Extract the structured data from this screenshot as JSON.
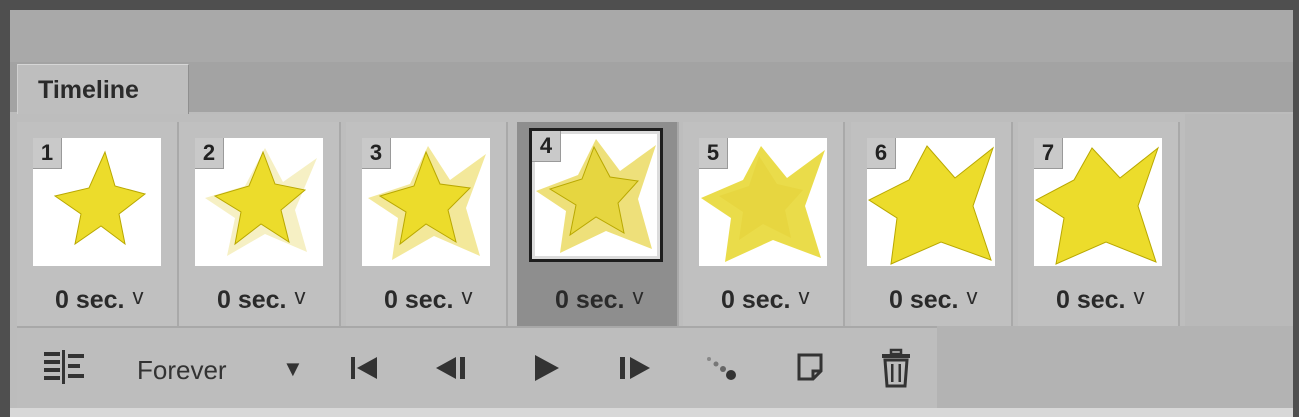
{
  "panel": {
    "tab_title": "Timeline"
  },
  "frames": [
    {
      "number": "1",
      "delay": "0 sec.",
      "chevron": "v",
      "selected": false
    },
    {
      "number": "2",
      "delay": "0 sec.",
      "chevron": "v",
      "selected": false
    },
    {
      "number": "3",
      "delay": "0 sec.",
      "chevron": "v",
      "selected": false
    },
    {
      "number": "4",
      "delay": "0 sec.",
      "chevron": "v",
      "selected": true
    },
    {
      "number": "5",
      "delay": "0 sec.",
      "chevron": "v",
      "selected": false
    },
    {
      "number": "6",
      "delay": "0 sec.",
      "chevron": "v",
      "selected": false
    },
    {
      "number": "7",
      "delay": "0 sec.",
      "chevron": "v",
      "selected": false
    }
  ],
  "toolbar": {
    "convert_icon": "convert-timeline-icon",
    "loop_value": "Forever",
    "loop_dropdown_icon": "triangle-down-icon",
    "first_frame_icon": "first-frame-icon",
    "prev_frame_icon": "previous-frame-icon",
    "play_icon": "play-icon",
    "next_frame_icon": "next-frame-icon",
    "tween_icon": "tween-icon",
    "duplicate_icon": "new-frame-icon",
    "delete_icon": "trash-icon"
  },
  "colors": {
    "star_fill": "#ecdc2b",
    "star_ghost": "#f3eaa0",
    "panel_bg": "#bdbdbd",
    "selected_frame_bg": "#8e8e8e"
  }
}
